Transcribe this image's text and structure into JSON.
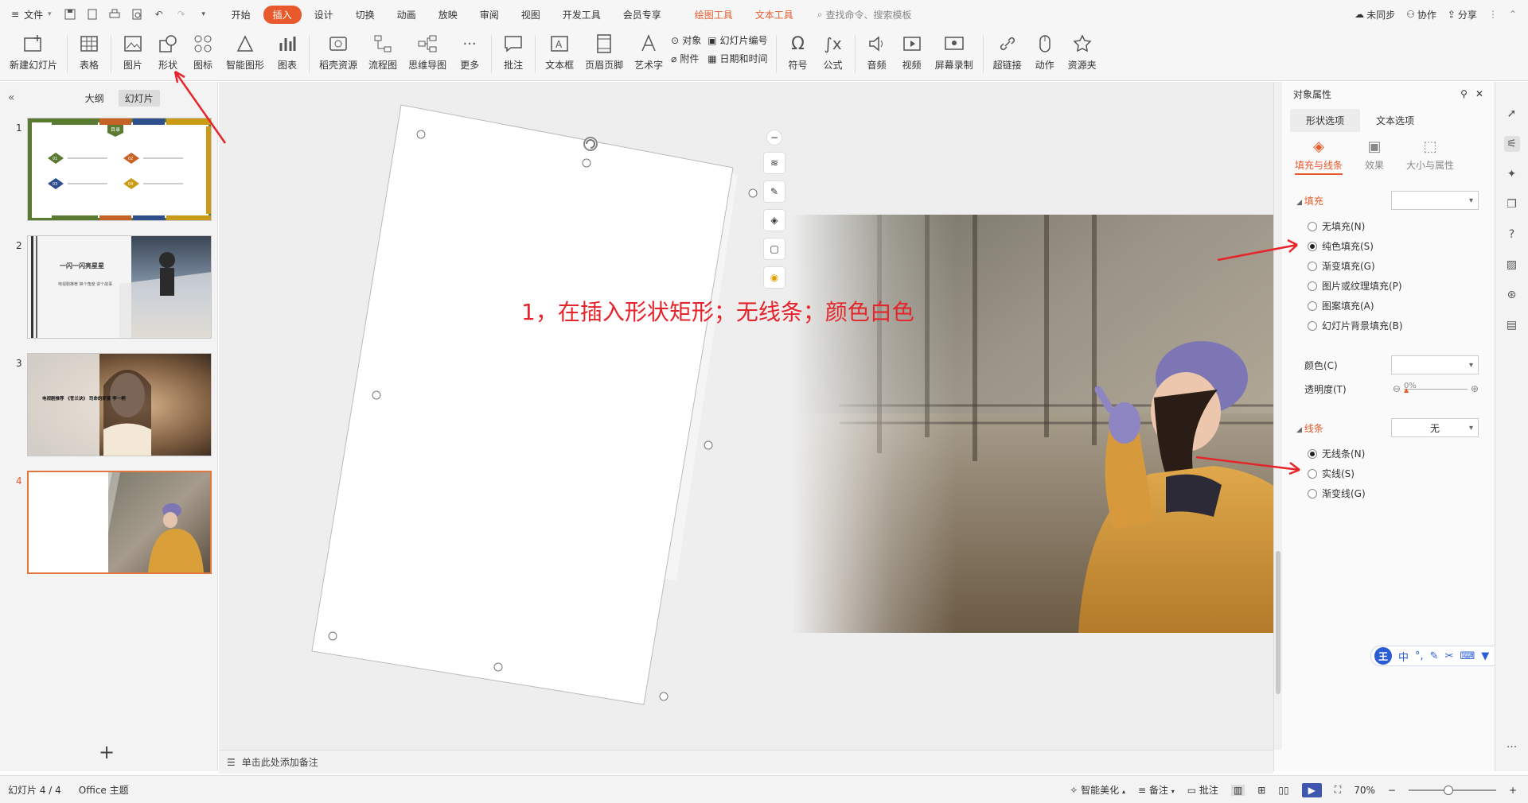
{
  "menubar": {
    "file": "文件",
    "tabs": [
      {
        "label": "开始",
        "state": "normal"
      },
      {
        "label": "插入",
        "state": "active"
      },
      {
        "label": "设计",
        "state": "normal"
      },
      {
        "label": "切换",
        "state": "normal"
      },
      {
        "label": "动画",
        "state": "normal"
      },
      {
        "label": "放映",
        "state": "normal"
      },
      {
        "label": "审阅",
        "state": "normal"
      },
      {
        "label": "视图",
        "state": "normal"
      },
      {
        "label": "开发工具",
        "state": "normal"
      },
      {
        "label": "会员专享",
        "state": "normal"
      },
      {
        "label": "绘图工具",
        "state": "orange"
      },
      {
        "label": "文本工具",
        "state": "orange"
      }
    ],
    "search": "查找命令、搜索模板",
    "sync": "未同步",
    "collab": "协作",
    "share": "分享"
  },
  "ribbon": {
    "new_slide": "新建幻灯片",
    "table": "表格",
    "picture": "图片",
    "shape": "形状",
    "icon": "图标",
    "smartart": "智能图形",
    "chart": "图表",
    "shell_res": "稻壳资源",
    "flowchart": "流程图",
    "mindmap": "思维导图",
    "more": "更多",
    "comment": "批注",
    "textbox": "文本框",
    "header_footer": "页眉页脚",
    "wordart": "艺术字",
    "object": "对象",
    "attachment": "附件",
    "slide_num": "幻灯片编号",
    "datetime": "日期和时间",
    "symbol": "符号",
    "formula": "公式",
    "audio": "音频",
    "video": "视频",
    "screen_rec": "屏幕录制",
    "hyperlink": "超链接",
    "action": "动作",
    "resources": "资源夹"
  },
  "leftpane": {
    "tab_outline": "大纲",
    "tab_slides": "幻灯片",
    "slides": [
      {
        "num": "1",
        "badge": "目录",
        "items": [
          "01",
          "02",
          "03",
          "04"
        ]
      },
      {
        "num": "2",
        "title": "一闪一闪亮星星",
        "text": "电视剧推荐 换个角度 讲个故事"
      },
      {
        "num": "3",
        "text": "电视剧推荐 《苍兰诀》 司命的家宴 李一桐"
      },
      {
        "num": "4"
      }
    ],
    "add": "+"
  },
  "canvas": {
    "annotation": "1，在插入形状矩形；无线条；颜色白色",
    "notes_placeholder": "单击此处添加备注"
  },
  "rpanel": {
    "title": "对象属性",
    "tab_shape": "形状选项",
    "tab_text": "文本选项",
    "sub_fill_line": "填充与线条",
    "sub_effect": "效果",
    "sub_size": "大小与属性",
    "fill_section": "填充",
    "fill_options": [
      "无填充(N)",
      "纯色填充(S)",
      "渐变填充(G)",
      "图片或纹理填充(P)",
      "图案填充(A)",
      "幻灯片背景填充(B)"
    ],
    "fill_selected": 1,
    "color_label": "颜色(C)",
    "transparency_label": "透明度(T)",
    "transparency_value": "0%",
    "line_section": "线条",
    "line_value": "无",
    "line_options": [
      "无线条(N)",
      "实线(S)",
      "渐变线(G)"
    ],
    "line_selected": 0
  },
  "statusbar": {
    "slide_info": "幻灯片 4 / 4",
    "theme": "Office 主题",
    "beautify": "智能美化",
    "notes": "备注",
    "comments": "批注",
    "zoom": "70%"
  },
  "ime": {
    "label": "王",
    "mode": "中"
  }
}
